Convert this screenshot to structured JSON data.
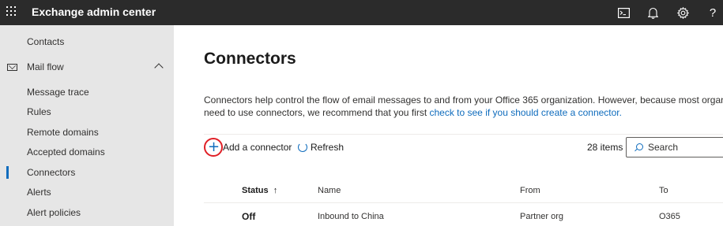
{
  "app": {
    "title": "Exchange admin center"
  },
  "topbar": {
    "icons": [
      "waffle-icon",
      "terminal-icon",
      "bell-icon",
      "gear-icon",
      "help-icon"
    ],
    "help_label": "?"
  },
  "sidebar": {
    "items": [
      {
        "label": "Contacts"
      },
      {
        "label": "Mail flow",
        "expanded": true
      },
      {
        "label": "Message trace"
      },
      {
        "label": "Rules"
      },
      {
        "label": "Remote domains"
      },
      {
        "label": "Accepted domains"
      },
      {
        "label": "Connectors",
        "active": true
      },
      {
        "label": "Alerts"
      },
      {
        "label": "Alert policies"
      }
    ]
  },
  "main": {
    "title": "Connectors",
    "description_line1": "Connectors help control the flow of email messages to and from your Office 365 organization. However, because most organizations",
    "description_line2_prefix": "need to use connectors, we recommend that you first ",
    "description_link": "check to see if you should create a connector.",
    "toolbar": {
      "add_label": "Add a connector",
      "refresh_label": "Refresh",
      "items_count": "28 items",
      "search_placeholder": "Search"
    },
    "table": {
      "columns": [
        "Status",
        "Name",
        "From",
        "To"
      ],
      "sort_indicator": "↑",
      "rows": [
        {
          "status": "Off",
          "name": "Inbound to China",
          "from": "Partner org",
          "to": "O365"
        }
      ]
    }
  },
  "colors": {
    "accent": "#0f6cbd",
    "topbar": "#2b2b2b",
    "sidebar": "#e6e6e6",
    "highlight_circle": "#e01f26"
  }
}
